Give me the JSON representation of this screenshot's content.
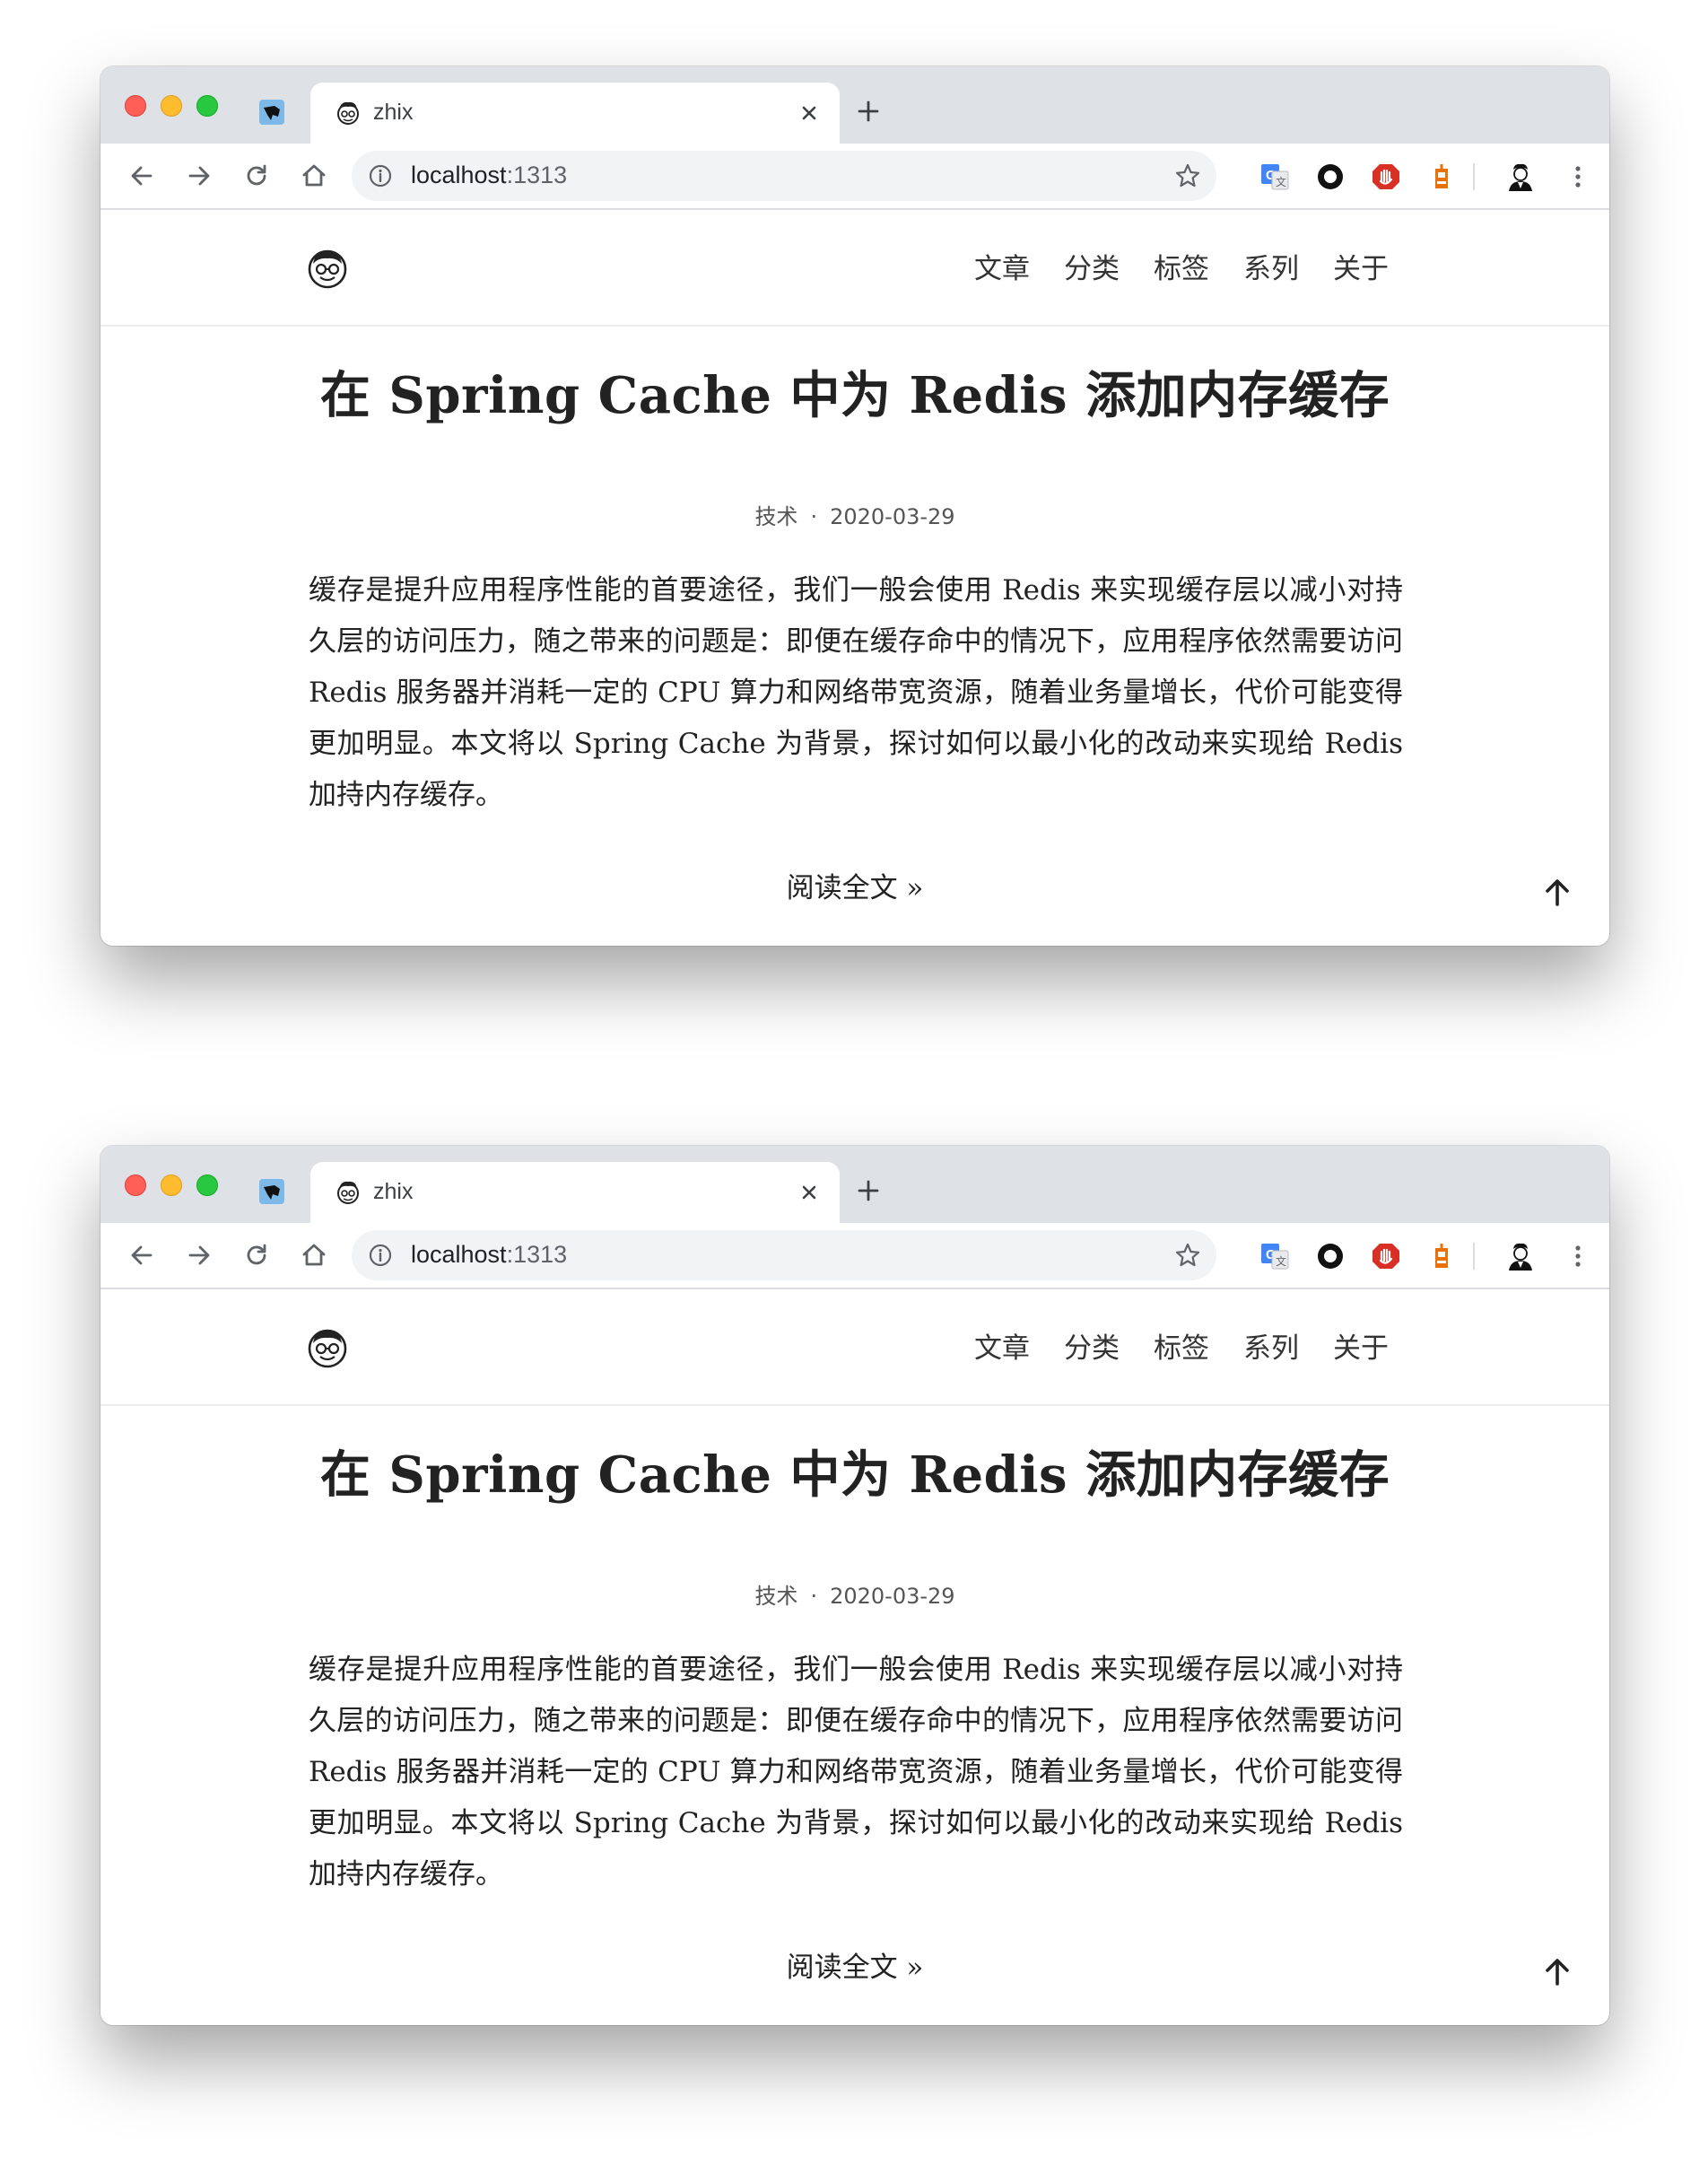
{
  "windows": [
    {
      "tab": {
        "title": "zhix"
      },
      "address_bar": {
        "host": "localhost",
        "port": ":1313"
      },
      "site": {
        "nav": [
          "文章",
          "分类",
          "标签",
          "系列",
          "关于"
        ]
      },
      "post": {
        "title": "在 Spring Cache 中为 Redis 添加内存缓存",
        "category": "技术",
        "separator": "·",
        "date": "2020-03-29",
        "summary": "缓存是提升应用程序性能的首要途径，我们一般会使用 Redis 来实现缓存层以减小对持久层的访问压力，随之带来的问题是：即便在缓存命中的情况下，应用程序依然需要访问 Redis 服务器并消耗一定的 CPU 算力和网络带宽资源，随着业务量增长，代价可能变得更加明显。本文将以 Spring Cache 为背景，探讨如何以最小化的改动来实现给 Redis 加持内存缓存。",
        "read_more": "阅读全文 »"
      }
    },
    {
      "tab": {
        "title": "zhix"
      },
      "address_bar": {
        "host": "localhost",
        "port": ":1313"
      },
      "site": {
        "nav": [
          "文章",
          "分类",
          "标签",
          "系列",
          "关于"
        ]
      },
      "post": {
        "title": "在 Spring Cache 中为 Redis 添加内存缓存",
        "category": "技术",
        "separator": "·",
        "date": "2020-03-29",
        "summary": "缓存是提升应用程序性能的首要途径，我们一般会使用 Redis 来实现缓存层以减小对持久层的访问压力，随之带来的问题是：即便在缓存命中的情况下，应用程序依然需要访问 Redis 服务器并消耗一定的 CPU 算力和网络带宽资源，随着业务量增长，代价可能变得更加明显。本文将以 Spring Cache 为背景，探讨如何以最小化的改动来实现给 Redis 加持内存缓存。",
        "read_more": "阅读全文 »"
      }
    }
  ],
  "icons": {
    "pinned_tab": "pinned-tab-icon",
    "favicon": "avatar-favicon-icon",
    "close": "close-icon",
    "new_tab": "plus-icon",
    "back": "back-arrow-icon",
    "forward": "forward-arrow-icon",
    "reload": "reload-icon",
    "home": "home-icon",
    "info": "info-icon",
    "star": "star-icon",
    "translate": "translate-extension-icon",
    "record": "circle-extension-icon",
    "shield": "shield-extension-icon",
    "robot": "robot-extension-icon",
    "profile": "profile-avatar-icon",
    "menu": "more-vertical-icon",
    "back_to_top": "arrow-up-icon"
  },
  "colors": {
    "tab_strip": "#dee1e6",
    "omnibox": "#f1f3f4",
    "close_red": "#ff5f57",
    "minimize_yellow": "#febc2e",
    "zoom_green": "#28c840"
  }
}
